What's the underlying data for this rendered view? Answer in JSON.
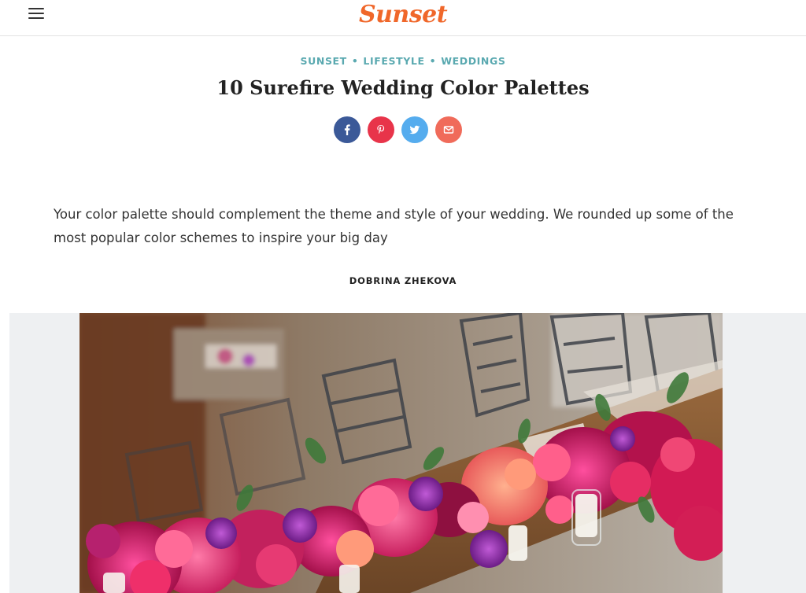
{
  "colors": {
    "brand": "#f0672a",
    "teal": "#5aa9b0",
    "facebook": "#3b5998",
    "pinterest": "#e8344a",
    "twitter": "#55acee",
    "email": "#f06b5a"
  },
  "header": {
    "logo": "Sunset",
    "menu_icon": "hamburger-icon"
  },
  "breadcrumb": {
    "items": [
      "SUNSET",
      "LIFESTYLE",
      "WEDDINGS"
    ],
    "separator": "•"
  },
  "article": {
    "title": "10 Surefire Wedding Color Palettes",
    "dek": "Your color palette should complement the theme and style of your wedding. We rounded up some of the most popular color schemes to inspire your big day",
    "author": "DOBRINA ZHEKOVA"
  },
  "share": {
    "icons": [
      "facebook-icon",
      "pinterest-icon",
      "twitter-icon",
      "email-icon"
    ]
  },
  "hero": {
    "image": "wedding-table-flowers-photo"
  }
}
